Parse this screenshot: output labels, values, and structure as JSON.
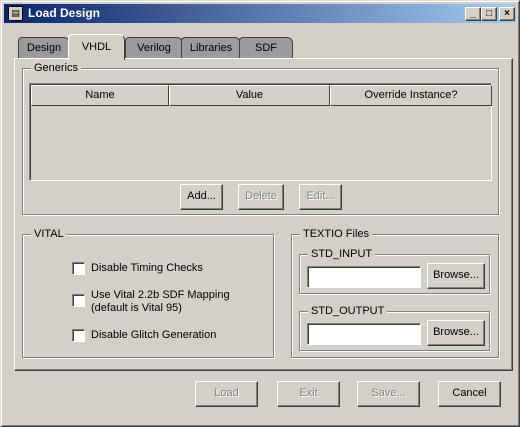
{
  "window": {
    "title": "Load Design",
    "icon": "document-icon"
  },
  "titlebar_buttons": {
    "minimize": "_",
    "maximize": "□",
    "close": "×"
  },
  "tabs": [
    {
      "label": "Design",
      "active": false
    },
    {
      "label": "VHDL",
      "active": true
    },
    {
      "label": "Verilog",
      "active": false
    },
    {
      "label": "Libraries",
      "active": false
    },
    {
      "label": "SDF",
      "active": false
    }
  ],
  "generics": {
    "label": "Generics",
    "columns": [
      "Name",
      "Value",
      "Override Instance?"
    ],
    "rows": [],
    "buttons": {
      "add": "Add...",
      "delete": "Delete",
      "edit": "Edit..."
    }
  },
  "vital": {
    "label": "VITAL",
    "options": [
      {
        "label": "Disable Timing Checks",
        "checked": false
      },
      {
        "label": "Use Vital 2.2b SDF Mapping",
        "label2": "(default is Vital 95)",
        "checked": false
      },
      {
        "label": "Disable Glitch Generation",
        "checked": false
      }
    ]
  },
  "textio": {
    "label": "TEXTIO Files",
    "std_input": {
      "label": "STD_INPUT",
      "value": "",
      "browse": "Browse..."
    },
    "std_output": {
      "label": "STD_OUTPUT",
      "value": "",
      "browse": "Browse..."
    }
  },
  "footer": {
    "load": "Load",
    "exit": "Exit",
    "save": "Save...",
    "cancel": "Cancel"
  }
}
